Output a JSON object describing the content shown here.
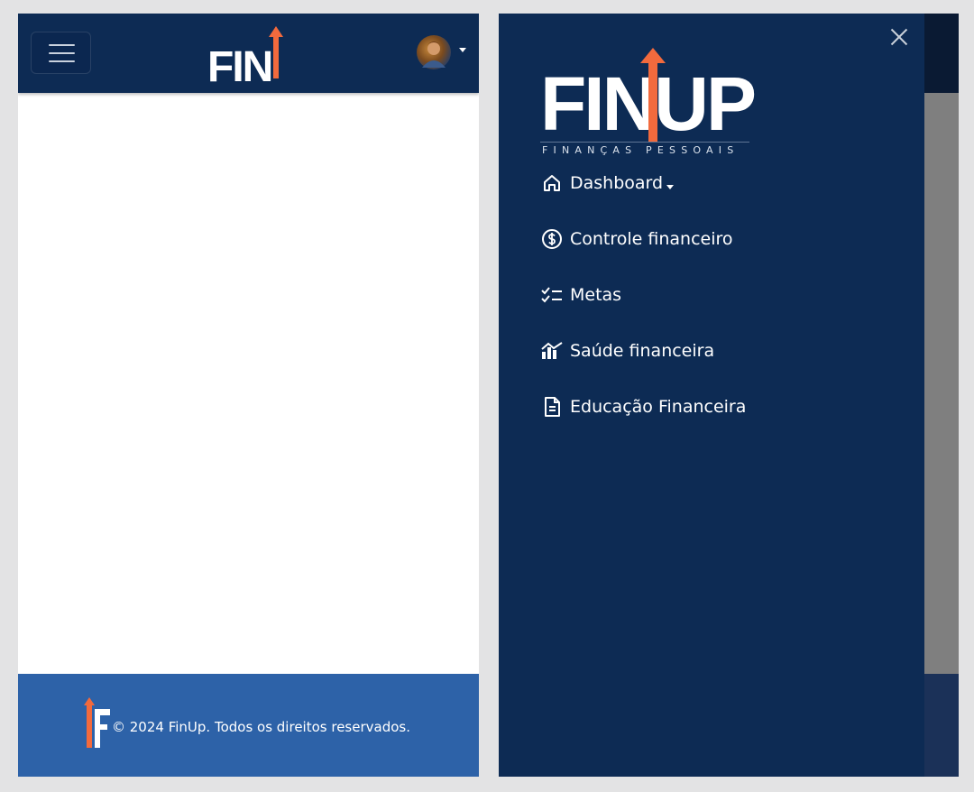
{
  "left_screen": {
    "header": {
      "logo_text": "FIN",
      "menu_button": "hamburger-menu",
      "avatar": "user-avatar"
    },
    "footer": {
      "copyright": "© 2024 FinUp. Todos os direitos reservados."
    }
  },
  "drawer": {
    "logo_text": "FINUP",
    "logo_tagline": "FINANÇAS PESSOAIS",
    "close_icon": "close-icon",
    "nav": [
      {
        "label": "Dashboard",
        "icon": "home-icon",
        "has_dropdown": true
      },
      {
        "label": "Controle financeiro",
        "icon": "dollar-circle-icon"
      },
      {
        "label": "Metas",
        "icon": "checklist-icon"
      },
      {
        "label": "Saúde financeira",
        "icon": "chart-trend-icon"
      },
      {
        "label": "Educação Financeira",
        "icon": "document-icon"
      }
    ]
  },
  "colors": {
    "navy": "#0d2b54",
    "footer_blue": "#2d62a8",
    "accent_orange": "#f26a3d",
    "overlay_gray": "#7f7f7f",
    "page_bg": "#e3e3e4"
  }
}
